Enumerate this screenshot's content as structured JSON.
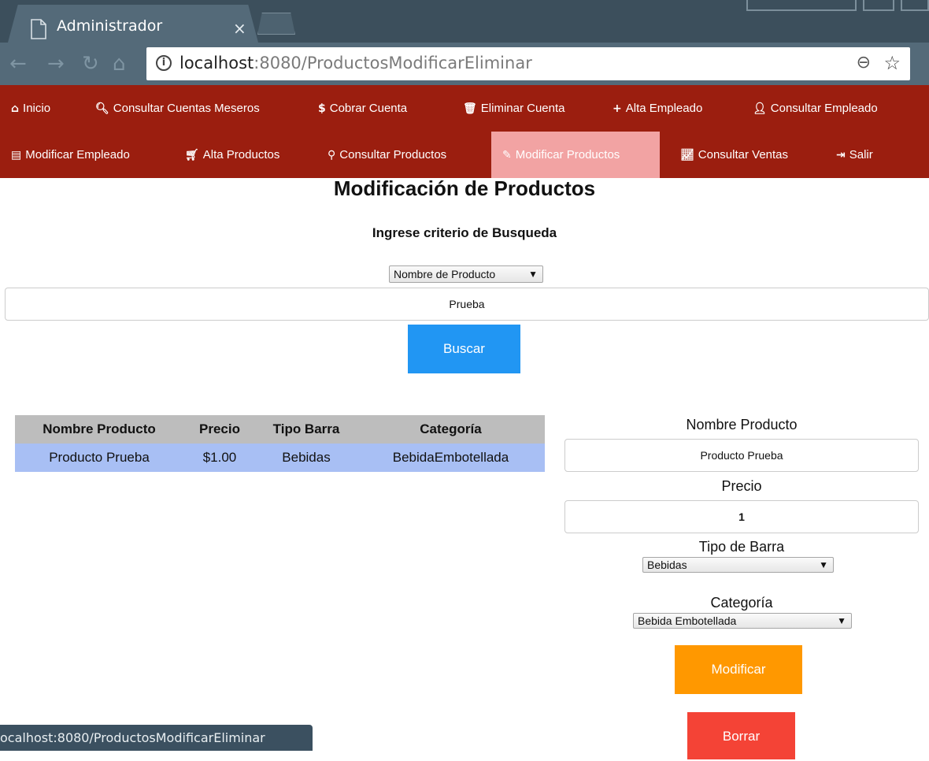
{
  "browser": {
    "tab_title": "Administrador",
    "close_glyph": "×",
    "url_host": "localhost",
    "url_path": ":8080/ProductosModificarEliminar",
    "status_url": "ocalhost:8080/ProductosModificarEliminar"
  },
  "nav": {
    "row1": [
      {
        "icon": "⌂",
        "label": "Inicio"
      },
      {
        "icon": "🔍︎",
        "label": "Consultar Cuentas Meseros"
      },
      {
        "icon": "$",
        "label": "Cobrar Cuenta"
      },
      {
        "icon": "🗑︎",
        "label": "Eliminar Cuenta"
      },
      {
        "icon": "+",
        "label": "Alta Empleado"
      },
      {
        "icon": "👤︎",
        "label": "Consultar Empleado"
      }
    ],
    "row2": [
      {
        "icon": "▤",
        "label": "Modificar Empleado"
      },
      {
        "icon": "🛒︎",
        "label": "Alta Productos"
      },
      {
        "icon": "⚲",
        "label": "Consultar Productos"
      },
      {
        "icon": "✎",
        "label": "Modificar Productos"
      },
      {
        "icon": "📈︎",
        "label": "Consultar Ventas"
      },
      {
        "icon": "⇥",
        "label": "Salir"
      }
    ]
  },
  "page": {
    "title": "Modificación de Productos",
    "subtitle": "Ingrese criterio de Busqueda",
    "criteria_select": "Nombre de Producto",
    "search_value": "Prueba",
    "search_button": "Buscar"
  },
  "table": {
    "headers": [
      "Nombre Producto",
      "Precio",
      "Tipo Barra",
      "Categoría"
    ],
    "rows": [
      [
        "Producto Prueba",
        "$1.00",
        "Bebidas",
        "BebidaEmbotellada"
      ]
    ]
  },
  "form": {
    "name_label": "Nombre Producto",
    "name_value": "Producto Prueba",
    "price_label": "Precio",
    "price_value": "1",
    "bar_label": "Tipo de Barra",
    "bar_value": "Bebidas",
    "category_label": "Categoría",
    "category_value": "Bebida Embotellada",
    "modify_button": "Modificar",
    "delete_button": "Borrar"
  },
  "colors": {
    "nav_bg": "#9b1e0f",
    "nav_active": "#f2a3a3",
    "buscar": "#2196f3",
    "modificar": "#ff9800",
    "borrar": "#f44336"
  }
}
